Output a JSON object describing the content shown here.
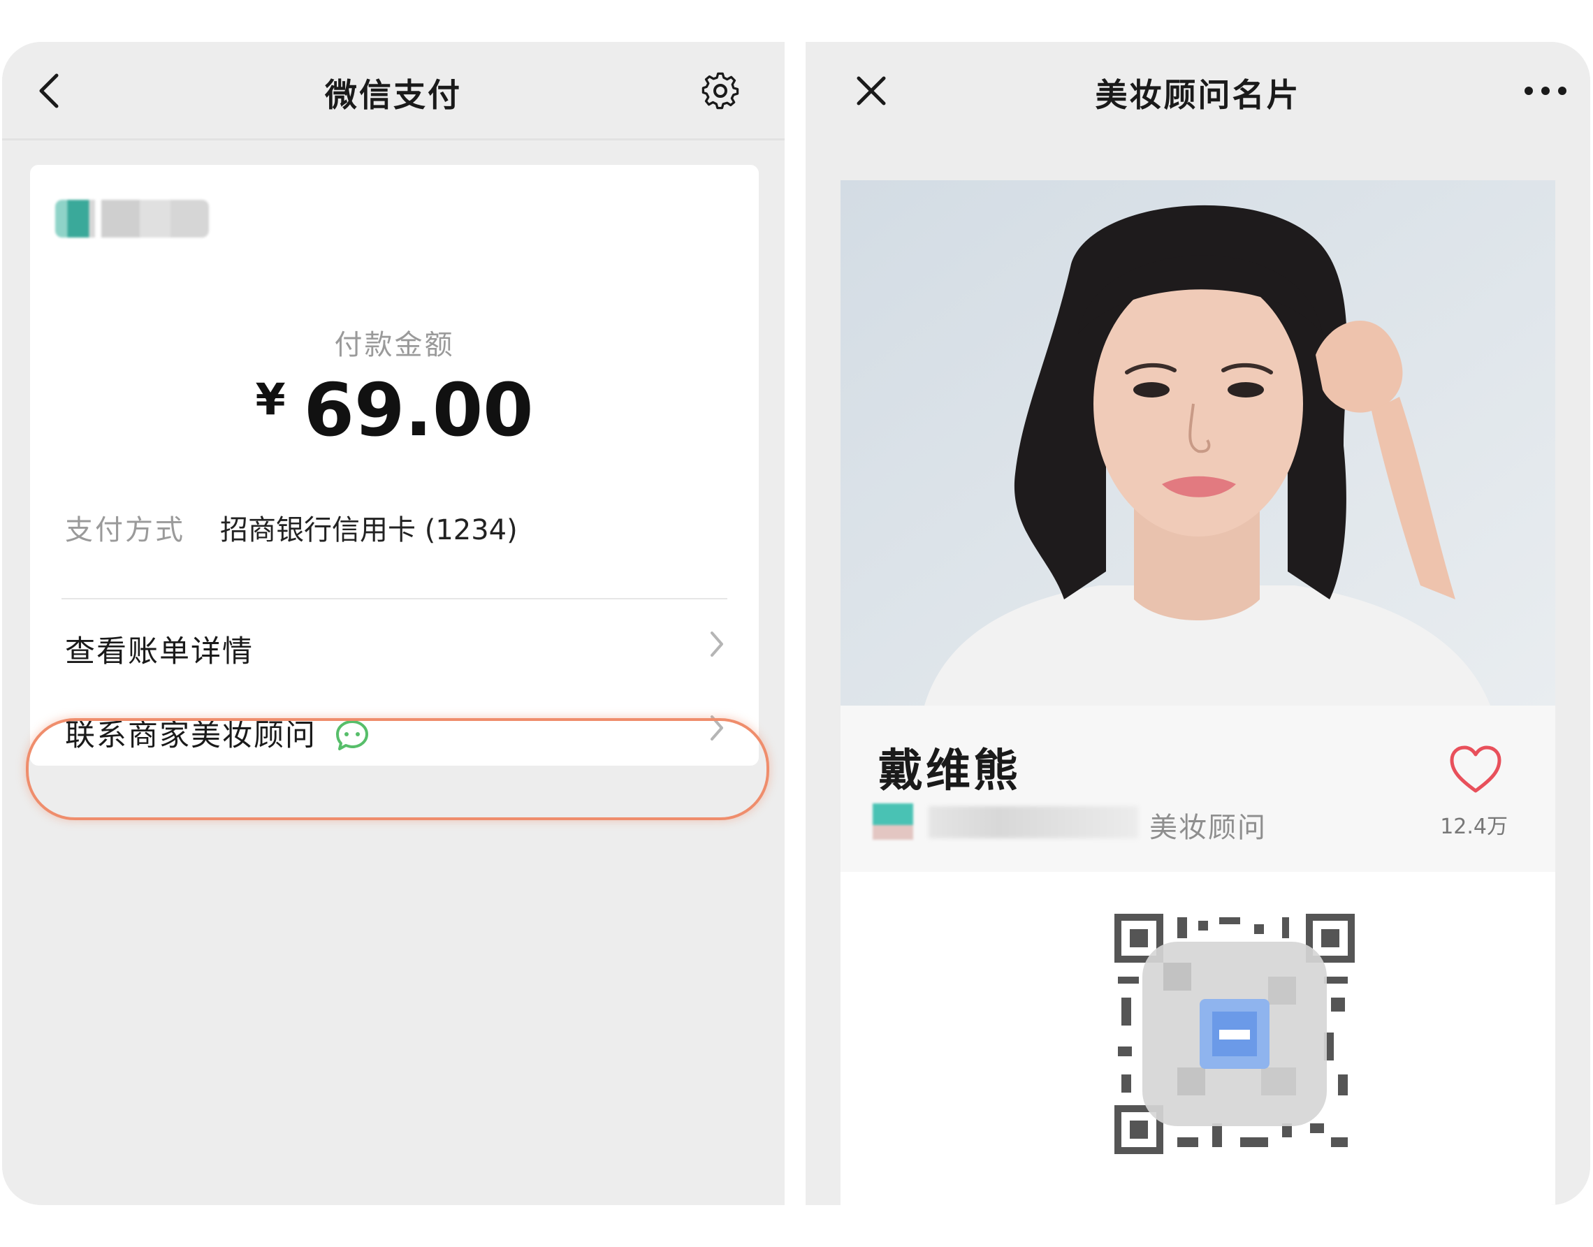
{
  "left_panel": {
    "nav": {
      "title": "微信支付",
      "back_icon": "chevron-left-icon",
      "settings_icon": "gear-icon"
    },
    "payment": {
      "amount_label": "付款金额",
      "currency": "¥",
      "amount": "69.00",
      "method_label": "支付方式",
      "method_value": "招商银行信用卡 (1234)"
    },
    "rows": [
      {
        "label": "查看账单详情"
      },
      {
        "label": "联系商家美妆顾问",
        "badge_icon": "wechat-chat-icon"
      }
    ]
  },
  "right_panel": {
    "nav": {
      "title": "美妆顾问名片",
      "close_icon": "close-icon",
      "more_icon": "more-icon"
    },
    "consultant": {
      "name": "戴维熊",
      "role": "美妆顾问",
      "likes": "12.4万"
    }
  },
  "colors": {
    "background": "#ededed",
    "highlight_ring": "#ef8d6c",
    "wechat_green": "#57be6a",
    "heart_red": "#e8505b"
  }
}
